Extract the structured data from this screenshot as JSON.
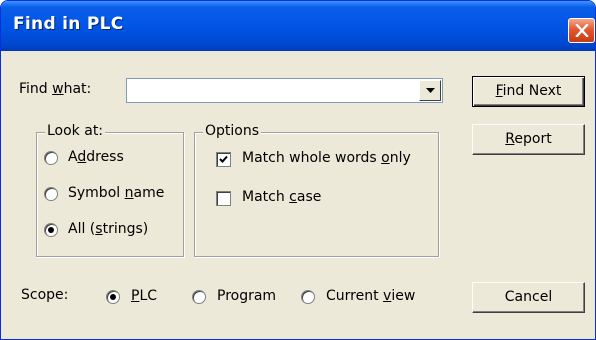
{
  "window": {
    "title": "Find in PLC"
  },
  "find": {
    "label_pre": "Find ",
    "label_accel": "w",
    "label_post": "hat:",
    "value": ""
  },
  "look_at": {
    "legend": "Look at:",
    "address": {
      "pre": "A",
      "accel": "d",
      "post": "dress",
      "selected": false
    },
    "symbol": {
      "pre": "Symbol ",
      "accel": "n",
      "post": "ame",
      "selected": false
    },
    "all": {
      "pre": "All (",
      "accel": "s",
      "post": "trings)",
      "selected": true
    }
  },
  "options": {
    "legend": "Options",
    "whole_words": {
      "pre": "Match whole words ",
      "accel": "o",
      "post": "nly",
      "checked": true
    },
    "match_case": {
      "pre": "Match ",
      "accel": "c",
      "post": "ase",
      "checked": false
    }
  },
  "scope": {
    "label": "Scope:",
    "plc": {
      "pre": "",
      "accel": "P",
      "post": "LC",
      "selected": true
    },
    "program": {
      "label": "Program",
      "selected": false
    },
    "current_view": {
      "pre": "Current ",
      "accel": "v",
      "post": "iew",
      "selected": false
    }
  },
  "buttons": {
    "find_next": {
      "pre": "",
      "accel": "F",
      "post": "ind Next"
    },
    "report": {
      "pre": "",
      "accel": "R",
      "post": "eport"
    },
    "cancel": "Cancel"
  },
  "colors": {
    "titlebar": "#0055e5",
    "dialog_bg": "#ece9d8",
    "close_button": "#e4582f"
  }
}
